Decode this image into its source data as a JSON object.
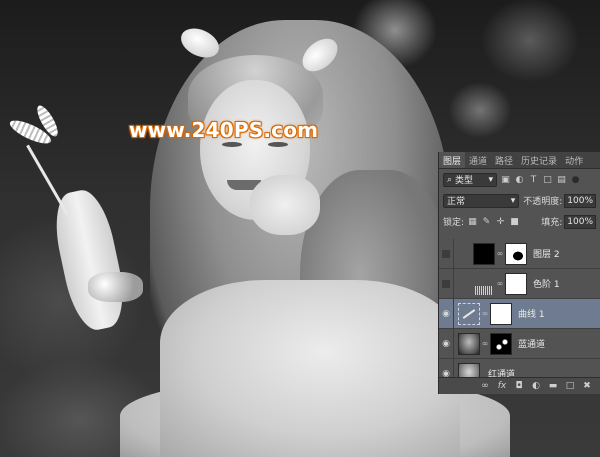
{
  "watermark": "www.240PS.com",
  "panel": {
    "tabs": [
      "图层",
      "通道",
      "路径",
      "历史记录",
      "动作"
    ],
    "filter": {
      "icon": "search-icon",
      "label": "类型"
    },
    "filter_icons": [
      "image-filter-icon",
      "adjustment-filter-icon",
      "text-filter-icon",
      "shape-filter-icon",
      "smart-filter-icon"
    ],
    "blend_mode": "正常",
    "opacity_label": "不透明度:",
    "opacity_value": "100%",
    "lock_label": "锁定:",
    "fill_label": "填充:",
    "fill_value": "100%",
    "layers": [
      {
        "name": "图层 2",
        "visible": false,
        "selected": false,
        "thumb": "black",
        "mask": "shape"
      },
      {
        "name": "色阶 1",
        "visible": false,
        "selected": false,
        "thumb": "levels-icon",
        "mask": "white"
      },
      {
        "name": "曲线 1",
        "visible": true,
        "selected": true,
        "thumb": "curves-icon",
        "mask": "white"
      },
      {
        "name": "蓝通道",
        "visible": true,
        "selected": false,
        "thumb": "photo",
        "mask": "spots"
      },
      {
        "name": "红通道",
        "visible": true,
        "selected": false,
        "thumb": "photo",
        "mask": null
      }
    ],
    "footer_icons": [
      "link-icon",
      "fx-icon",
      "mask-icon",
      "adjustment-icon",
      "group-icon",
      "new-layer-icon",
      "trash-icon"
    ]
  }
}
